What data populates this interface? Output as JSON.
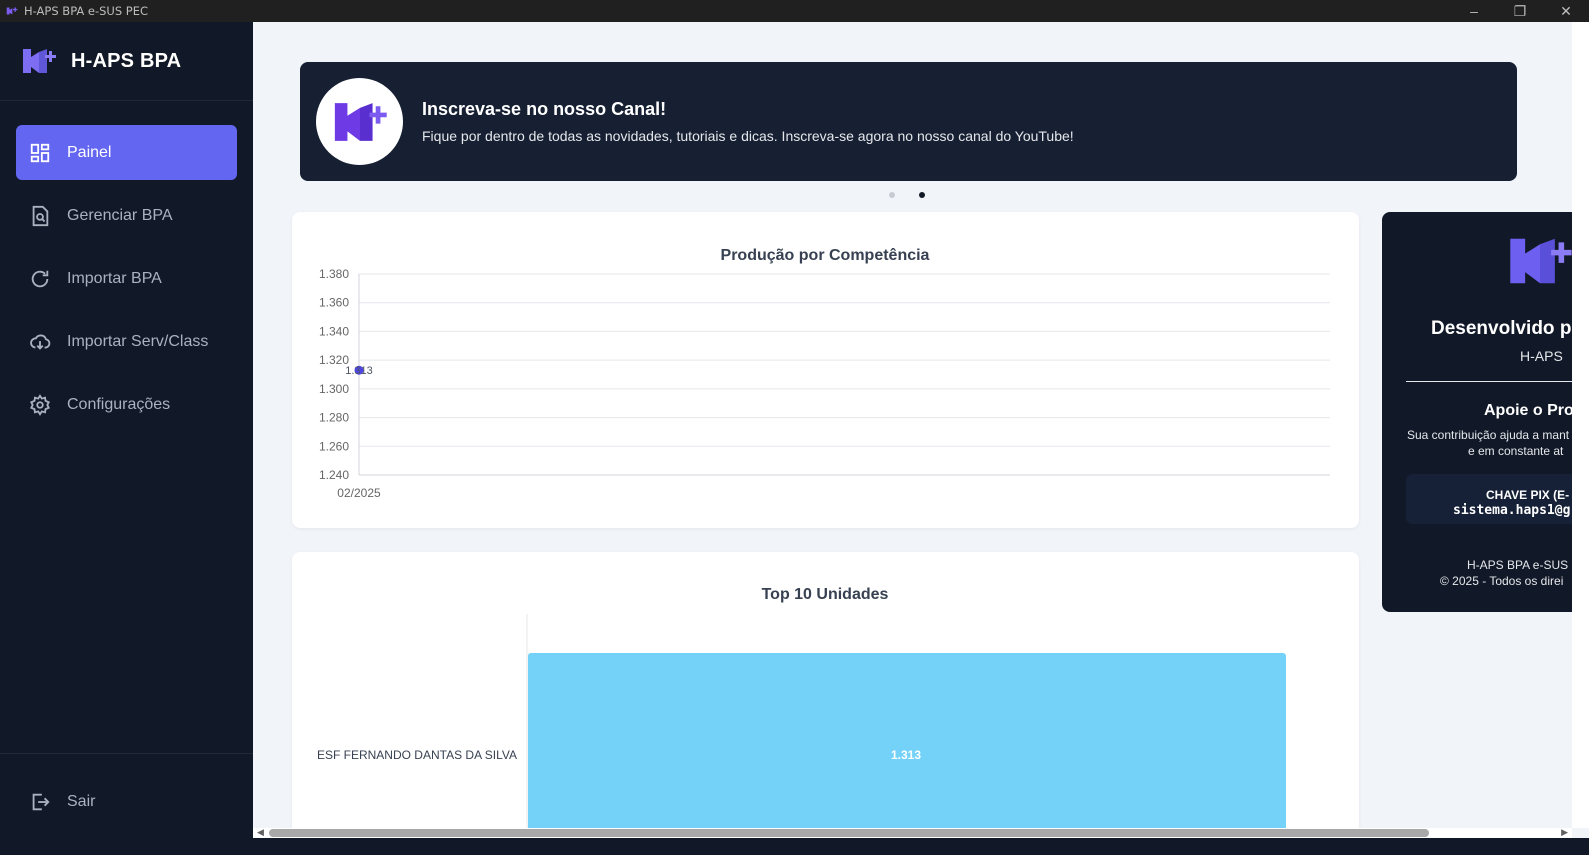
{
  "window": {
    "title": "H-APS BPA e-SUS PEC"
  },
  "sidebar": {
    "brand": "H-APS BPA",
    "items": [
      {
        "label": "Painel",
        "icon": "dashboard-icon",
        "active": true
      },
      {
        "label": "Gerenciar BPA",
        "icon": "document-search-icon",
        "active": false
      },
      {
        "label": "Importar BPA",
        "icon": "refresh-icon",
        "active": false
      },
      {
        "label": "Importar Serv/Class",
        "icon": "cloud-download-icon",
        "active": false
      },
      {
        "label": "Configurações",
        "icon": "gear-icon",
        "active": false
      }
    ],
    "logout": "Sair"
  },
  "banner": {
    "title": "Inscreva-se no nosso Canal!",
    "description": "Fique por dentro de todas as novidades, tutoriais e dicas. Inscreva-se agora no nosso canal do YouTube!",
    "active_slide": 2,
    "total_slides": 2
  },
  "support": {
    "title": "Desenvolvido p",
    "subtitle": "H-APS",
    "heading": "Apoie o Pro",
    "text_line1": "Sua contribuição ajuda a mant",
    "text_line2": "e em constante at",
    "pix_label": "CHAVE PIX (E-",
    "pix_key": "sistema.haps1@g",
    "footer_line1": "H-APS BPA e-SUS",
    "footer_line2": "© 2025 - Todos os direi"
  },
  "colors": {
    "accent": "#6366f1",
    "sidebar_bg": "#111827",
    "bar_fill": "#74d1f8",
    "line_point": "#4f46e5"
  },
  "chart_data": [
    {
      "type": "line",
      "title": "Produção por Competência",
      "categories": [
        "02/2025"
      ],
      "series": [
        {
          "values": [
            1313
          ],
          "labels": [
            "1.313"
          ]
        }
      ],
      "yticks": [
        "1.380",
        "1.360",
        "1.340",
        "1.320",
        "1.300",
        "1.280",
        "1.260",
        "1.240"
      ],
      "ylim": [
        1240,
        1380
      ],
      "grid": true
    },
    {
      "type": "bar",
      "orientation": "horizontal",
      "title": "Top 10 Unidades",
      "categories": [
        "ESF FERNANDO DANTAS DA SILVA"
      ],
      "values": [
        1313
      ],
      "labels": [
        "1.313"
      ],
      "xlim": [
        0,
        1313
      ]
    }
  ]
}
